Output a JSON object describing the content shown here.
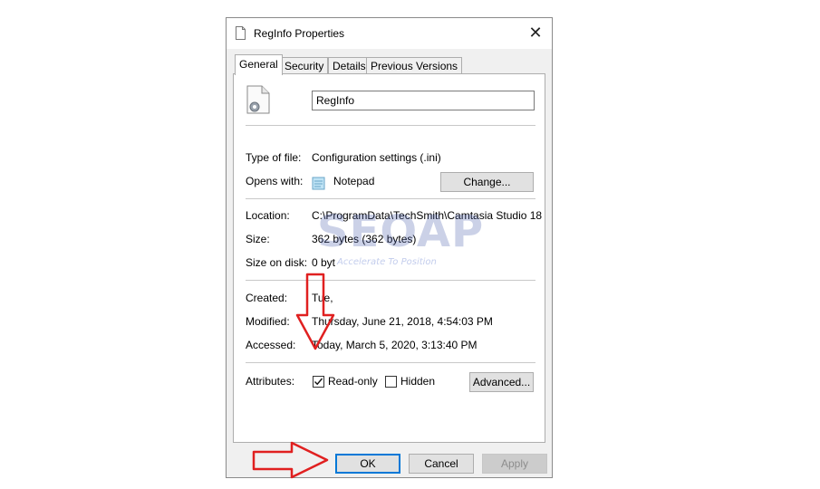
{
  "window": {
    "title": "RegInfo Properties",
    "close_glyph": "✕"
  },
  "tabs": [
    "General",
    "Security",
    "Details",
    "Previous Versions"
  ],
  "general": {
    "file_name": "RegInfo",
    "type_label": "Type of file:",
    "type_value": "Configuration settings (.ini)",
    "opens_label": "Opens with:",
    "opens_value": "Notepad",
    "change_button": "Change...",
    "location_label": "Location:",
    "location_value": "C:\\ProgramData\\TechSmith\\Camtasia Studio 18",
    "size_label": "Size:",
    "size_value": "362 bytes (362 bytes)",
    "size_disk_label": "Size on disk:",
    "size_disk_value": "0 byt",
    "created_label": "Created:",
    "created_value": "Tue,",
    "modified_label": "Modified:",
    "modified_value": "Thursday, June 21, 2018, 4:54:03 PM",
    "accessed_label": "Accessed:",
    "accessed_value": "Today, March 5, 2020, 3:13:40 PM",
    "attributes_label": "Attributes:",
    "readonly_label": "Read-only",
    "readonly_checked": true,
    "hidden_label": "Hidden",
    "hidden_checked": false,
    "advanced_button": "Advanced..."
  },
  "footer": {
    "ok": "OK",
    "cancel": "Cancel",
    "apply": "Apply"
  },
  "watermark": {
    "brand": "SEOAP",
    "tagline": "Accelerate To Position"
  },
  "annotation_color": "#e02020",
  "accent_color": "#0078d7"
}
